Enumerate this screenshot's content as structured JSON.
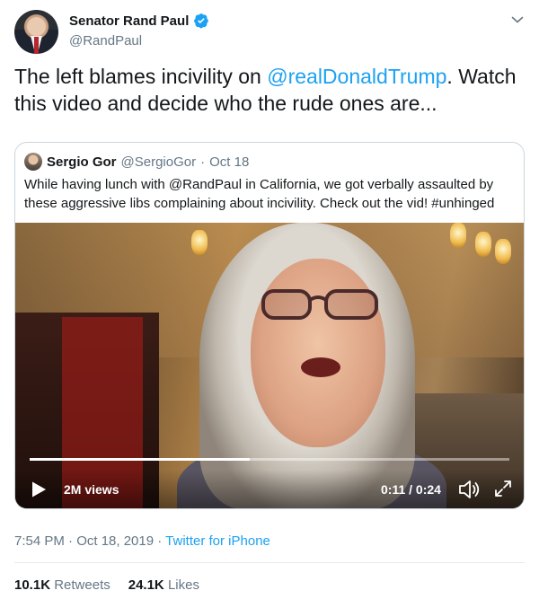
{
  "author": {
    "name": "Senator Rand Paul",
    "handle": "@RandPaul"
  },
  "tweet": {
    "text_before": "The left blames incivility on ",
    "mention": "@realDonaldTrump",
    "text_after": ". Watch this video and decide who the rude ones are..."
  },
  "quoted": {
    "name": "Sergio Gor",
    "handle": "@SergioGor",
    "dot": "·",
    "date": "Oct 18",
    "text": "While having lunch with @RandPaul in California, we got verbally assaulted by these aggressive libs complaining about incivility. Check out the vid! #unhinged"
  },
  "video": {
    "views": "2M views",
    "time": "0:11 / 0:24",
    "progress_fraction": 0.458
  },
  "meta": {
    "time_date": "7:54 PM · Oct 18, 2019",
    "separator": " · ",
    "source": "Twitter for iPhone"
  },
  "stats": {
    "retweets_count": "10.1K",
    "retweets_label": "Retweets",
    "likes_count": "24.1K",
    "likes_label": "Likes"
  },
  "colors": {
    "link": "#1da1f2",
    "secondary": "#657786",
    "primary": "#14171a"
  },
  "icons": {
    "verified": "verified-badge-icon",
    "menu": "chevron-down-icon",
    "play": "play-icon",
    "volume": "volume-icon",
    "fullscreen": "fullscreen-icon"
  }
}
